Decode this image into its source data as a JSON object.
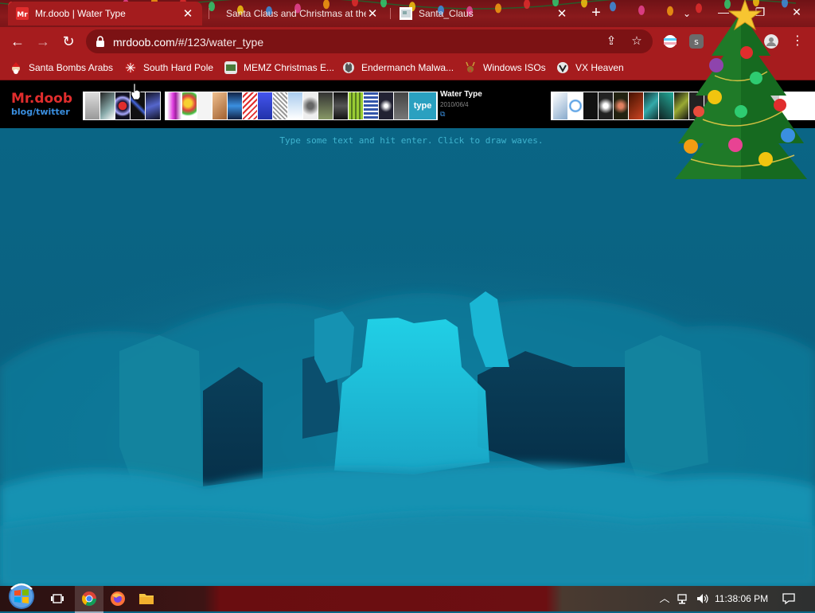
{
  "tabs": [
    {
      "title": "Mr.doob | Water Type",
      "favicon_text": "Mr",
      "active": true
    },
    {
      "title": "Santa Claus and Christmas at the",
      "active": false
    },
    {
      "title": "Santa_Claus",
      "active": false
    }
  ],
  "tab_close_glyph": "✕",
  "new_tab_glyph": "+",
  "tab_search_glyph": "⌄",
  "window_controls": {
    "minimize": "—",
    "maximize": "❐",
    "close": "✕"
  },
  "nav": {
    "back": "←",
    "forward": "→",
    "reload": "↻"
  },
  "address": {
    "domain": "mrdoob.com",
    "path": "/#/123/water_type"
  },
  "omnibox_icons": {
    "share": "⇪",
    "bookmark": "☆",
    "menu": "⋮"
  },
  "bookmarks": [
    {
      "label": "Santa Bombs Arabs",
      "icon": "santa-icon"
    },
    {
      "label": "South Hard Pole",
      "icon": "snowflake-icon"
    },
    {
      "label": "MEMZ Christmas E...",
      "icon": "memz-icon"
    },
    {
      "label": "Endermanch Malwa...",
      "icon": "wolf-icon"
    },
    {
      "label": "Windows ISOs",
      "icon": "reindeer-icon"
    },
    {
      "label": "VX Heaven",
      "icon": "vx-icon"
    }
  ],
  "site": {
    "logo_title": "Mr.doob",
    "logo_subtitle": "blog/twitter",
    "project_name": "Water Type",
    "project_date": "2010/06/4",
    "project_link_glyph": "⧉",
    "thumb_type_label": "type"
  },
  "hint_text": "Type some text and hit enter. Click to draw waves.",
  "colors": {
    "chrome_dark": "#7b1518",
    "chrome": "#a61c1e",
    "water_deep": "#0a6585",
    "water_bright": "#18c9e4",
    "accent_red": "#e02d2d",
    "accent_blue": "#3a8fe0"
  },
  "taskbar": {
    "apps": [
      "file-explorer-icon",
      "chrome-icon",
      "firefox-icon",
      "folder-icon"
    ],
    "clock": "11:38:06 PM"
  }
}
